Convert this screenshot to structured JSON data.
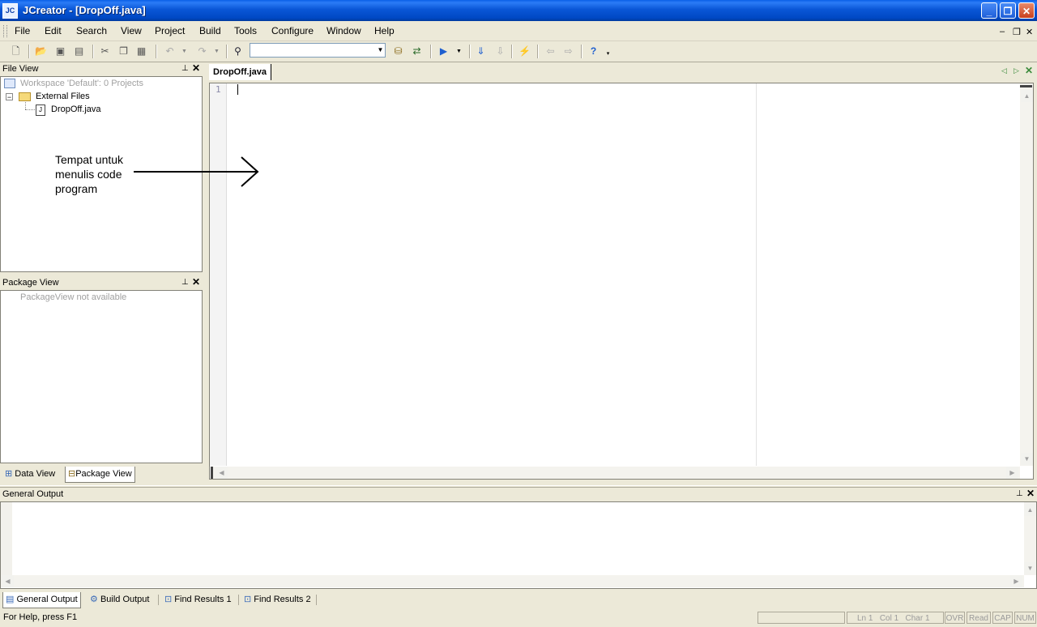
{
  "window": {
    "title": "JCreator - [DropOff.java]",
    "icon": "JC",
    "minimize": "_",
    "restore": "❐",
    "close": "✕"
  },
  "menu": [
    "File",
    "Edit",
    "Search",
    "View",
    "Project",
    "Build",
    "Tools",
    "Configure",
    "Window",
    "Help"
  ],
  "mdi_controls": {
    "minimize": "‒",
    "restore": "❐",
    "close": "✕"
  },
  "file_view": {
    "title": "File View",
    "workspace": "Workspace 'Default': 0 Projects",
    "folder": "External Files",
    "file": "DropOff.java"
  },
  "package_view": {
    "title": "Package View",
    "message": "PackageView not available"
  },
  "left_tabs": [
    "Data View",
    "Package View"
  ],
  "editor": {
    "tab": "DropOff.java",
    "line_number": "1"
  },
  "annotation": "Tempat untuk menulis code program",
  "output": {
    "title": "General Output"
  },
  "bottom_tabs": [
    "General Output",
    "Build Output",
    "Find Results 1",
    "Find Results 2"
  ],
  "status": {
    "help": "For Help, press F1",
    "ln": "Ln 1",
    "col": "Col 1",
    "char": "Char 1",
    "ovr": "OVR",
    "read": "Read",
    "cap": "CAP",
    "num": "NUM"
  }
}
